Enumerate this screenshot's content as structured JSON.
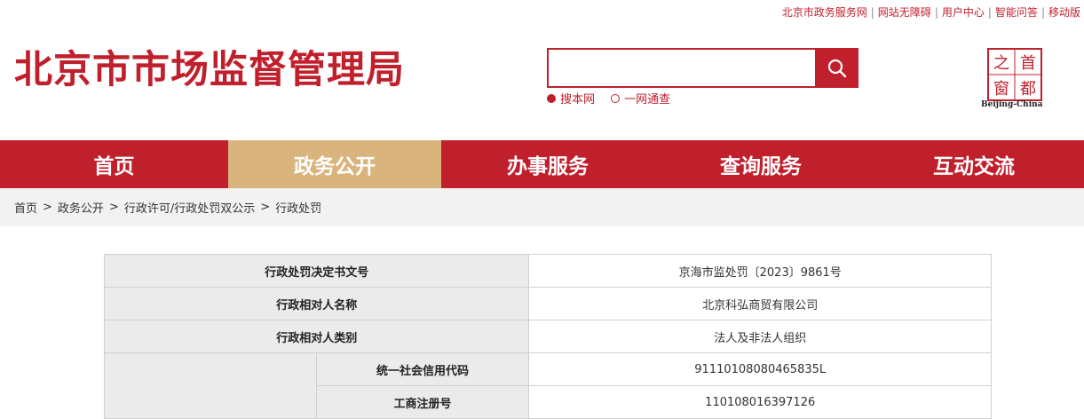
{
  "top_links": [
    "北京市政务服务网",
    "网站无障碍",
    "用户中心",
    "智能问答",
    "移动版"
  ],
  "site_title": "北京市市场监督管理局",
  "search": {
    "placeholder": "",
    "options": [
      {
        "label": "搜本网",
        "selected": true
      },
      {
        "label": "一网通查",
        "selected": false
      }
    ],
    "button_icon": "search-icon"
  },
  "logo": {
    "chars": [
      "首",
      "都",
      "之",
      "窗"
    ],
    "caption": "Beijing-China"
  },
  "nav": [
    {
      "label": "首页",
      "active": false
    },
    {
      "label": "政务公开",
      "active": true
    },
    {
      "label": "办事服务",
      "active": false
    },
    {
      "label": "查询服务",
      "active": false
    },
    {
      "label": "互动交流",
      "active": false
    }
  ],
  "breadcrumb": {
    "items": [
      "首页",
      "政务公开",
      "行政许可/行政处罚双公示",
      "行政处罚"
    ],
    "separator": ">"
  },
  "table": {
    "rows": [
      {
        "label": "行政处罚决定书文号",
        "value": "京海市监处罚〔2023〕9861号"
      },
      {
        "label": "行政相对人名称",
        "value": "北京科弘商贸有限公司"
      },
      {
        "label": "行政相对人类别",
        "value": "法人及非法人组织"
      },
      {
        "sublabel": "统一社会信用代码",
        "value": "91110108080465835L"
      },
      {
        "sublabel": "工商注册号",
        "value": "110108016397126"
      }
    ]
  },
  "colors": {
    "brand_red": "#c01f2c",
    "active_tab": "#d9b47d",
    "label_bg": "#ebebeb",
    "crumb_bg": "#f2f2f2"
  }
}
